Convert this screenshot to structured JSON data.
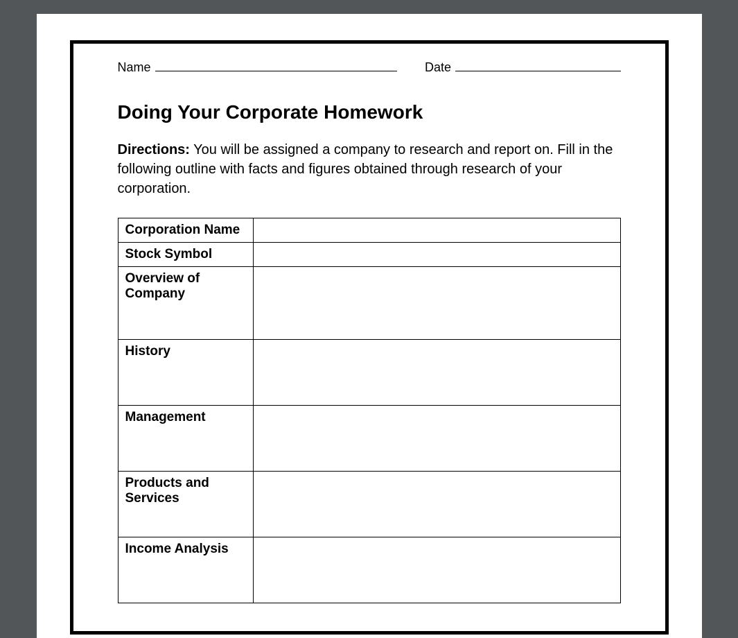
{
  "header": {
    "name_label": "Name",
    "date_label": "Date"
  },
  "title": "Doing Your Corporate Homework",
  "directions": {
    "lead": "Directions:",
    "body": " You will be assigned a company to research and report on. Fill in the following outline with facts and figures obtained through research of your corporation."
  },
  "table": {
    "rows": [
      {
        "label": "Corporation Name",
        "value": "",
        "height": "short"
      },
      {
        "label": "Stock Symbol",
        "value": "",
        "height": "short"
      },
      {
        "label": "Overview of Company",
        "value": "",
        "height": "xtall"
      },
      {
        "label": "History",
        "value": "",
        "height": "tall"
      },
      {
        "label": "Management",
        "value": "",
        "height": "tall"
      },
      {
        "label": "Products and Services",
        "value": "",
        "height": "tall"
      },
      {
        "label": "Income Analysis",
        "value": "",
        "height": "tall"
      }
    ]
  }
}
